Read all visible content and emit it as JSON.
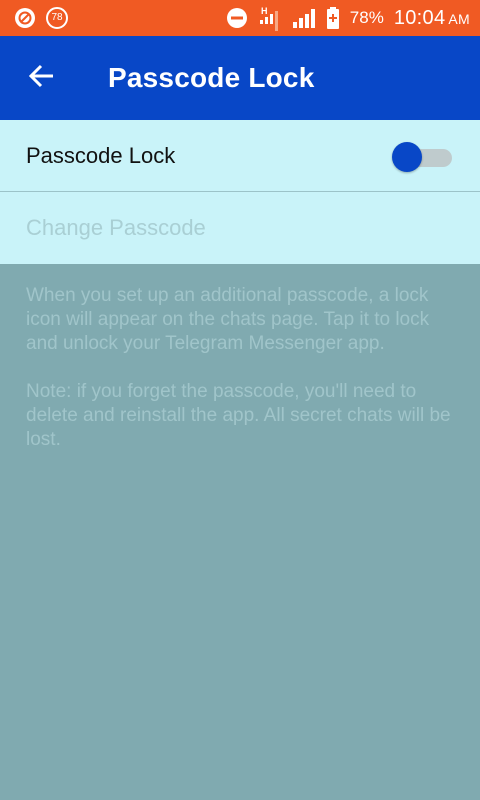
{
  "status_bar": {
    "notification_count": "78",
    "battery_percent": "78%",
    "time": "10:04",
    "ampm": "AM",
    "network_label": "H",
    "colors": {
      "background": "#f05a23"
    },
    "icons": [
      "shield-icon",
      "notification-badge",
      "do-not-disturb-icon",
      "network-data-icon",
      "signal-icon",
      "battery-icon"
    ]
  },
  "header": {
    "title": "Passcode Lock",
    "back_icon": "arrow-left-icon",
    "colors": {
      "background": "#0847c7",
      "text": "#ffffff"
    }
  },
  "settings": {
    "passcode_lock_label": "Passcode Lock",
    "passcode_lock_enabled": false,
    "change_passcode_label": "Change Passcode",
    "change_passcode_enabled": false,
    "colors": {
      "background": "#c9f3f9",
      "toggle_thumb": "#0847c7",
      "toggle_track": "#bfcbcd"
    }
  },
  "info": {
    "paragraph_1": "When you set up an additional passcode, a lock icon will appear on the chats page. Tap it to lock and unlock your Telegram Messenger app.",
    "paragraph_2": "Note: if you forget the passcode, you'll need to delete and reinstall the app. All secret chats will be lost."
  },
  "overlay_color": "#80aab0"
}
